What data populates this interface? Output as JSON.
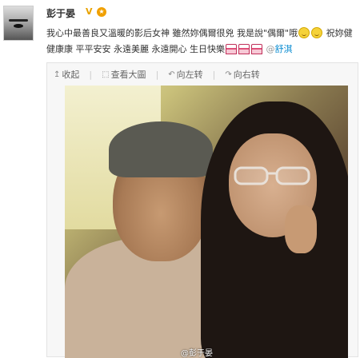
{
  "post": {
    "username": "彭于晏",
    "verified_badge": "V",
    "text_line1": "我心中最善良又溫暖的影后女神 雖然妳偶爾很兇 我是說\"偶爾\"哦",
    "text_line2_a": "祝妳健",
    "text_line2_b": "健康康 平平安安 永遠美麗 永遠開心 生日快樂",
    "mention": "舒淇",
    "icons": [
      "smile-emoji",
      "smile-emoji",
      "cake-emoji",
      "cake-emoji",
      "cake-emoji",
      "at-icon"
    ]
  },
  "toolbar": {
    "collapse": "收起",
    "view_large": "查看大圖",
    "rotate_left": "向左转",
    "rotate_right": "向右转"
  },
  "photo": {
    "watermark": "@彭于晏"
  }
}
